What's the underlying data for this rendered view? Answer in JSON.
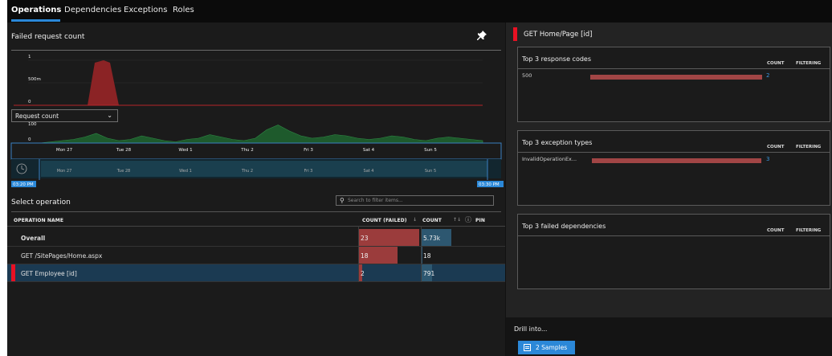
{
  "tabs": [
    {
      "label": "Operations",
      "active": true
    },
    {
      "label": "Dependencies",
      "active": false
    },
    {
      "label": "Exceptions",
      "active": false
    },
    {
      "label": "Roles",
      "active": false
    }
  ],
  "left": {
    "chart_title": "Failed request count",
    "dropdown_value": "Request count",
    "select_operation_title": "Select operation",
    "search_placeholder": "Search to filter items...",
    "time_start": "03:20 PM",
    "time_end": "03:30 PM",
    "table": {
      "headers": {
        "name": "OPERATION NAME",
        "failed": "COUNT (FAILED)",
        "count": "COUNT",
        "pin": "PIN"
      },
      "rows": [
        {
          "name": "Overall",
          "failed": "23",
          "count": "5.73k",
          "failed_value": 23,
          "count_value": 5730,
          "selected": false
        },
        {
          "name": "GET /SitePages/Home.aspx",
          "failed": "18",
          "count": "18",
          "failed_value": 18,
          "count_value": 18,
          "selected": false
        },
        {
          "name": "GET Employee [id]",
          "failed": "2",
          "count": "791",
          "failed_value": 2,
          "count_value": 791,
          "selected": true
        }
      ]
    }
  },
  "right": {
    "operation_title": "GET Home/Page [id]",
    "cards": [
      {
        "title": "Top 3 response codes",
        "count_h": "COUNT",
        "filter_h": "FILTERING",
        "items": [
          {
            "label": "500",
            "value": "2",
            "fraction": 1.0
          }
        ]
      },
      {
        "title": "Top 3 exception types",
        "count_h": "COUNT",
        "filter_h": "FILTERING",
        "items": [
          {
            "label": "InvalidOperationEx...",
            "value": "3",
            "fraction": 1.0
          }
        ]
      },
      {
        "title": "Top 3 failed dependencies",
        "count_h": "COUNT",
        "filter_h": "FILTERING",
        "items": []
      }
    ],
    "drill_label": "Drill into...",
    "samples_button": "2 Samples"
  },
  "colors": {
    "failed_area": "#8b2325",
    "request_area": "#1e5a2c",
    "accent_blue": "#2b88d8",
    "selected_mark": "#e81123"
  },
  "chart_data": [
    {
      "type": "area",
      "title": "Failed request count",
      "x": [
        "Mon 27",
        "Tue 28",
        "Wed 1",
        "Thu 2",
        "Fri 3",
        "Sat 4",
        "Sun 5"
      ],
      "y_ticks": [
        "1",
        "500m",
        "0"
      ],
      "ylim": [
        0,
        1
      ],
      "series": [
        {
          "values": [
            0,
            0,
            0,
            1,
            0,
            0,
            0,
            0,
            0,
            0,
            0,
            0,
            0,
            0,
            0,
            0,
            0,
            0,
            0,
            0,
            0,
            0,
            0,
            0,
            0,
            0,
            0,
            0,
            0,
            0,
            0,
            0,
            0,
            0,
            0,
            0,
            0,
            0,
            0,
            0
          ]
        }
      ]
    },
    {
      "type": "area",
      "title": "Request count",
      "x": [
        "Mon 27",
        "Tue 28",
        "Wed 1",
        "Thu 2",
        "Fri 3",
        "Sat 4",
        "Sun 5"
      ],
      "y_ticks": [
        "100",
        "0"
      ],
      "ylim": [
        0,
        100
      ],
      "series": [
        {
          "values": [
            0,
            5,
            10,
            15,
            25,
            40,
            20,
            10,
            15,
            30,
            20,
            10,
            5,
            15,
            20,
            35,
            25,
            15,
            10,
            20,
            55,
            75,
            50,
            30,
            20,
            25,
            35,
            30,
            20,
            15,
            20,
            30,
            25,
            15,
            10,
            20,
            25,
            20,
            15,
            10
          ]
        }
      ]
    },
    {
      "type": "area",
      "title": "Time range",
      "x": [
        "Mon 27",
        "Tue 28",
        "Wed 1",
        "Thu 2",
        "Fri 3",
        "Sat 4",
        "Sun 5"
      ],
      "series": []
    }
  ]
}
